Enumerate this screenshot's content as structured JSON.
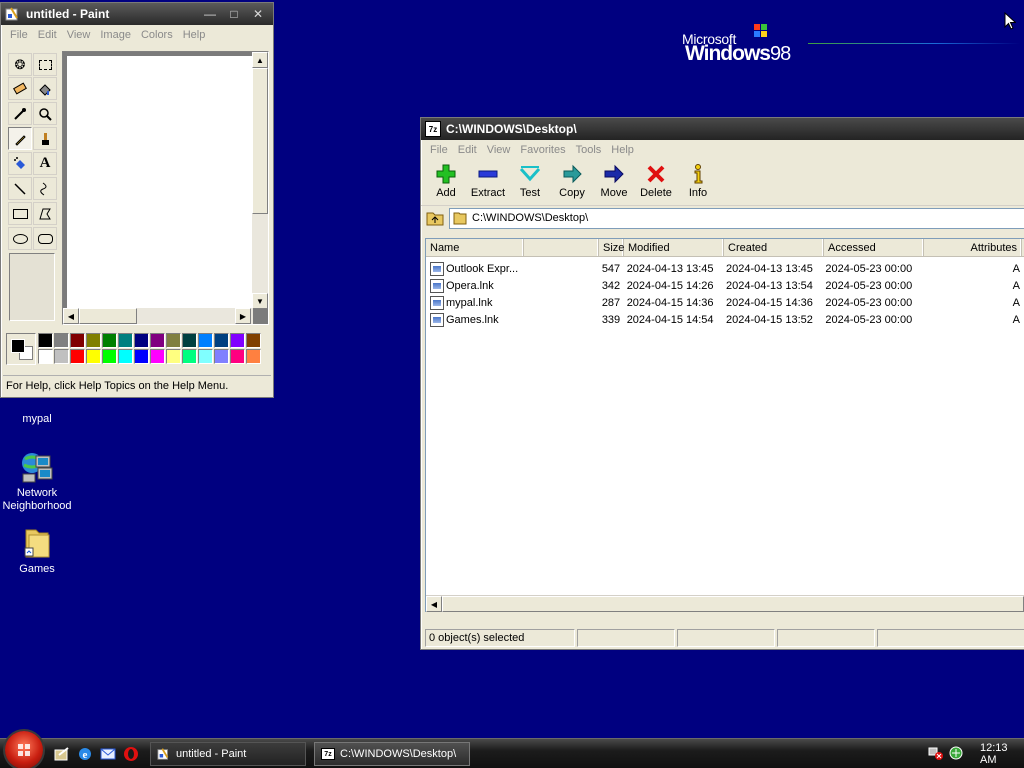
{
  "desktop": {
    "logo": {
      "microsoft": "Microsoft",
      "windows": "Windows",
      "version": "98"
    },
    "icons": [
      {
        "label": "mypal"
      },
      {
        "label": "Network Neighborhood"
      },
      {
        "label": "Games"
      }
    ]
  },
  "paint": {
    "title": "untitled - Paint",
    "menu": [
      "File",
      "Edit",
      "View",
      "Image",
      "Colors",
      "Help"
    ],
    "status": "For Help, click Help Topics on the Help Menu.",
    "palette": [
      "#000000",
      "#808080",
      "#800000",
      "#808000",
      "#008000",
      "#008080",
      "#000080",
      "#800080",
      "#808040",
      "#004040",
      "#0080ff",
      "#004080",
      "#8000ff",
      "#804000",
      "#ffffff",
      "#c0c0c0",
      "#ff0000",
      "#ffff00",
      "#00ff00",
      "#00ffff",
      "#0000ff",
      "#ff00ff",
      "#ffff80",
      "#00ff80",
      "#80ffff",
      "#8080ff",
      "#ff0080",
      "#ff8040"
    ]
  },
  "sevenzip": {
    "title": "C:\\WINDOWS\\Desktop\\",
    "menu": [
      "File",
      "Edit",
      "View",
      "Favorites",
      "Tools",
      "Help"
    ],
    "toolbar": [
      {
        "label": "Add",
        "icon": "add-icon"
      },
      {
        "label": "Extract",
        "icon": "extract-icon"
      },
      {
        "label": "Test",
        "icon": "test-icon"
      },
      {
        "label": "Copy",
        "icon": "copy-icon"
      },
      {
        "label": "Move",
        "icon": "move-icon"
      },
      {
        "label": "Delete",
        "icon": "delete-icon"
      },
      {
        "label": "Info",
        "icon": "info-icon"
      }
    ],
    "address": "C:\\WINDOWS\\Desktop\\",
    "columns": [
      "Name",
      "Size",
      "Modified",
      "Created",
      "Accessed",
      "Attributes"
    ],
    "rows": [
      {
        "name": "Outlook Expr...",
        "size": "547",
        "modified": "2024-04-13 13:45",
        "created": "2024-04-13 13:45",
        "accessed": "2024-05-23 00:00",
        "attributes": "A"
      },
      {
        "name": "Opera.lnk",
        "size": "342",
        "modified": "2024-04-15 14:26",
        "created": "2024-04-13 13:54",
        "accessed": "2024-05-23 00:00",
        "attributes": "A"
      },
      {
        "name": "mypal.lnk",
        "size": "287",
        "modified": "2024-04-15 14:36",
        "created": "2024-04-15 14:36",
        "accessed": "2024-05-23 00:00",
        "attributes": "A"
      },
      {
        "name": "Games.lnk",
        "size": "339",
        "modified": "2024-04-15 14:54",
        "created": "2024-04-15 13:52",
        "accessed": "2024-05-23 00:00",
        "attributes": "A"
      }
    ],
    "status": "0 object(s) selected"
  },
  "taskbar": {
    "tasks": [
      {
        "label": "untitled - Paint"
      },
      {
        "label": "C:\\WINDOWS\\Desktop\\"
      }
    ],
    "clock": "12:13 AM"
  },
  "colors": {
    "desktop": "#000080",
    "accent_red": "#c81e10"
  }
}
